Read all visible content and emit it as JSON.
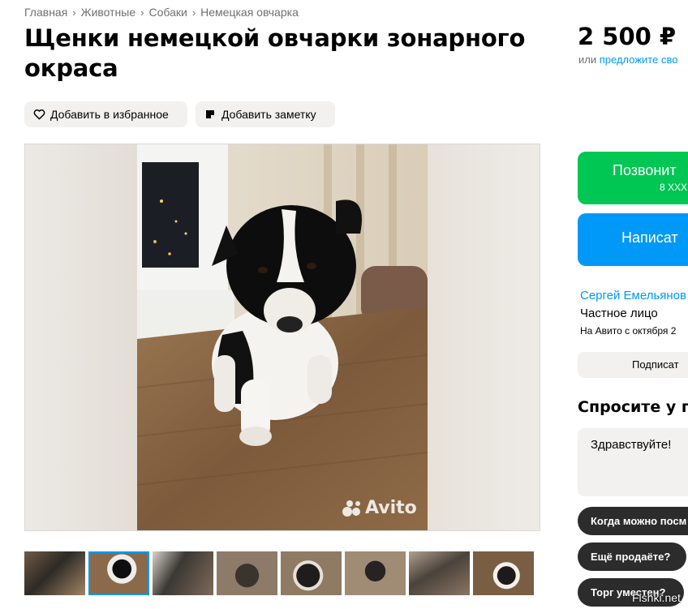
{
  "breadcrumbs": [
    {
      "label": "Главная"
    },
    {
      "label": "Животные"
    },
    {
      "label": "Собаки"
    },
    {
      "label": "Немецкая овчарка"
    }
  ],
  "listing": {
    "title": "Щенки немецкой овчарки зонарного окраса"
  },
  "actions": {
    "favorite_label": "Добавить в избранное",
    "note_label": "Добавить заметку"
  },
  "price": {
    "value": "2 500 ₽",
    "prefix": "или",
    "offer_link": "предложите сво"
  },
  "contact": {
    "call_label": "Позвонит",
    "phone_masked": "8 XXX",
    "message_label": "Написат"
  },
  "seller": {
    "name": "Сергей Емельянов",
    "type": "Частное лицо",
    "since": "На Авито с октября 2",
    "subscribe_label": "Подписат"
  },
  "ask": {
    "title": "Спросите у пр",
    "message_value": "Здравствуйте!",
    "quick_replies": [
      "Когда можно посм",
      "Ещё продаёте?",
      "Торг уместен?"
    ]
  },
  "gallery": {
    "watermark": "Avito",
    "thumbnail_count": 8,
    "active_index": 1
  },
  "site_watermark": "Fishki.net",
  "icons": {
    "favorite": "heart-icon",
    "note": "sticky-note-icon",
    "breadcrumb_separator": "chevron-right-icon"
  },
  "colors": {
    "accent_blue": "#0099f7",
    "call_green": "#00c653",
    "pill_bg": "#f2f1f0",
    "chip_dark": "#2c2c2c"
  }
}
